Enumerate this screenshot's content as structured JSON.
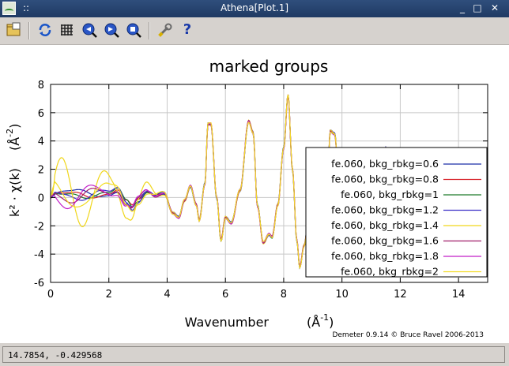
{
  "window": {
    "title": "Athena[Plot.1]",
    "minimize_glyph": "_",
    "maximize_glyph": "□",
    "close_glyph": "✕",
    "menu_glyph": "::"
  },
  "toolbar": {
    "icons": [
      "open-folder-icon",
      "refresh-icon",
      "grid-icon",
      "zoom-in-icon",
      "zoom-out-icon",
      "zoom-reset-icon",
      "settings-wrench-icon",
      "help-icon"
    ],
    "help_glyph": "?"
  },
  "status": {
    "coordinates": "14.7854, -0.429568"
  },
  "credit": "Demeter 0.9.14 © Bruce Ravel 2006-2013",
  "chart_data": {
    "type": "line",
    "title": "marked groups",
    "xlabel": "Wavenumber",
    "xlabel_unit_base": "(Å",
    "xlabel_unit_exp": "-1",
    "xlabel_unit_close": ")",
    "ylabel": "k² · χ(k)",
    "ylabel_unit_base": "(Å",
    "ylabel_unit_exp": "-2",
    "ylabel_unit_close": ")",
    "xlim": [
      0,
      15
    ],
    "ylim": [
      -6,
      8
    ],
    "xticks": [
      0,
      2,
      4,
      6,
      8,
      10,
      12,
      14
    ],
    "yticks": [
      -6,
      -4,
      -2,
      0,
      2,
      4,
      6,
      8
    ],
    "grid": true,
    "legend_placement": "right",
    "series": [
      {
        "name": "fe.060, bkg_rbkg=0.6",
        "color": "#1a2fa8",
        "low_amp": 0.5,
        "low_freq": 2.2,
        "low_phase": 0.0
      },
      {
        "name": "fe.060, bkg_rbkg=0.8",
        "color": "#d8232a",
        "low_amp": 0.35,
        "low_freq": 2.6,
        "low_phase": 0.4
      },
      {
        "name": "fe.060, bkg_rbkg=1",
        "color": "#1e7a2a",
        "low_amp": 0.3,
        "low_freq": 3.0,
        "low_phase": 0.8
      },
      {
        "name": "fe.060, bkg_rbkg=1.2",
        "color": "#3a2fc8",
        "low_amp": 0.45,
        "low_freq": 3.4,
        "low_phase": 1.2
      },
      {
        "name": "fe.060, bkg_rbkg=1.4",
        "color": "#f0d61a",
        "low_amp": 3.0,
        "low_freq": 4.2,
        "low_phase": 0.0
      },
      {
        "name": "fe.060, bkg_rbkg=1.6",
        "color": "#a01e6a",
        "low_amp": 0.6,
        "low_freq": 3.8,
        "low_phase": 2.0
      },
      {
        "name": "fe.060, bkg_rbkg=1.8",
        "color": "#c21ec8",
        "low_amp": 1.0,
        "low_freq": 3.6,
        "low_phase": 2.6
      },
      {
        "name": "fe.060, bkg_rbkg=2",
        "color": "#f2dc24",
        "low_amp": 1.2,
        "low_freq": 3.2,
        "low_phase": 1.6
      }
    ],
    "envelope_points": [
      [
        0.0,
        0.0
      ],
      [
        1.0,
        0.2
      ],
      [
        2.0,
        0.3
      ],
      [
        2.3,
        0.6
      ],
      [
        2.6,
        -0.3
      ],
      [
        2.8,
        -0.7
      ],
      [
        3.0,
        -0.2
      ],
      [
        3.3,
        0.4
      ],
      [
        3.6,
        0.1
      ],
      [
        3.9,
        0.3
      ],
      [
        4.2,
        -1.1
      ],
      [
        4.4,
        -1.4
      ],
      [
        4.6,
        -0.2
      ],
      [
        4.8,
        0.8
      ],
      [
        5.0,
        -0.5
      ],
      [
        5.1,
        -1.6
      ],
      [
        5.3,
        1.0
      ],
      [
        5.4,
        5.2
      ],
      [
        5.5,
        5.2
      ],
      [
        5.7,
        0.0
      ],
      [
        5.85,
        -3.0
      ],
      [
        6.0,
        -1.4
      ],
      [
        6.2,
        -1.8
      ],
      [
        6.5,
        0.5
      ],
      [
        6.8,
        5.4
      ],
      [
        6.95,
        4.6
      ],
      [
        7.1,
        -0.6
      ],
      [
        7.3,
        -3.2
      ],
      [
        7.5,
        -2.6
      ],
      [
        7.6,
        -2.8
      ],
      [
        7.8,
        -0.5
      ],
      [
        8.0,
        3.5
      ],
      [
        8.15,
        7.2
      ],
      [
        8.3,
        2.0
      ],
      [
        8.45,
        -3.0
      ],
      [
        8.55,
        -4.9
      ],
      [
        8.7,
        -3.4
      ],
      [
        8.85,
        -1.6
      ],
      [
        9.0,
        -2.8
      ],
      [
        9.2,
        -2.2
      ],
      [
        9.5,
        1.5
      ],
      [
        9.6,
        4.7
      ],
      [
        9.75,
        4.5
      ],
      [
        9.9,
        0.8
      ],
      [
        10.0,
        -1.2
      ],
      [
        10.15,
        0.2
      ],
      [
        10.3,
        -2.4
      ],
      [
        10.45,
        -2.2
      ],
      [
        10.6,
        0.8
      ],
      [
        10.8,
        2.6
      ],
      [
        11.0,
        -1.4
      ],
      [
        11.2,
        -2.6
      ],
      [
        11.4,
        2.6
      ],
      [
        11.5,
        3.5
      ],
      [
        11.7,
        0.5
      ],
      [
        11.9,
        -2.2
      ],
      [
        12.1,
        3.4
      ],
      [
        12.3,
        2.8
      ],
      [
        12.5,
        -0.8
      ],
      [
        12.7,
        -2.2
      ],
      [
        12.9,
        0.6
      ],
      [
        13.1,
        -1.0
      ],
      [
        13.4,
        1.0
      ],
      [
        13.6,
        -0.8
      ],
      [
        13.8,
        0.4
      ],
      [
        14.0,
        -0.6
      ],
      [
        14.2,
        0.8
      ],
      [
        14.4,
        0.2
      ],
      [
        14.6,
        -0.9
      ],
      [
        14.8,
        0.4
      ],
      [
        15.0,
        -0.2
      ]
    ]
  }
}
